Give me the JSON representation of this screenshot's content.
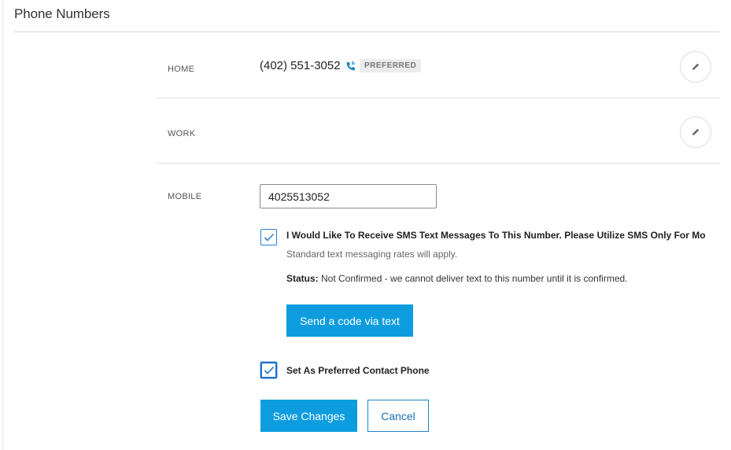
{
  "section": {
    "title": "Phone Numbers"
  },
  "rows": {
    "home": {
      "label": "HOME",
      "number": "(402) 551-3052",
      "badge": "PREFERRED",
      "icon": "phone-wave-icon"
    },
    "work": {
      "label": "WORK"
    },
    "mobile": {
      "label": "MOBILE",
      "value": "4025513052"
    }
  },
  "sms": {
    "checked": true,
    "label": "I Would Like To Receive SMS Text Messages To This Number. Please Utilize SMS Only For Mo",
    "note": "Standard text messaging rates will apply.",
    "status_label": "Status:",
    "status_text": "Not Confirmed - we cannot deliver text to this number until it is confirmed.",
    "send_code_label": "Send a code via text"
  },
  "preferred": {
    "checked": true,
    "label": "Set As Preferred Contact Phone"
  },
  "actions": {
    "save_label": "Save Changes",
    "cancel_label": "Cancel"
  },
  "colors": {
    "accent": "#0d9ddf",
    "checkbox_border": "#2a7fd3",
    "badge_bg": "#ececec"
  }
}
